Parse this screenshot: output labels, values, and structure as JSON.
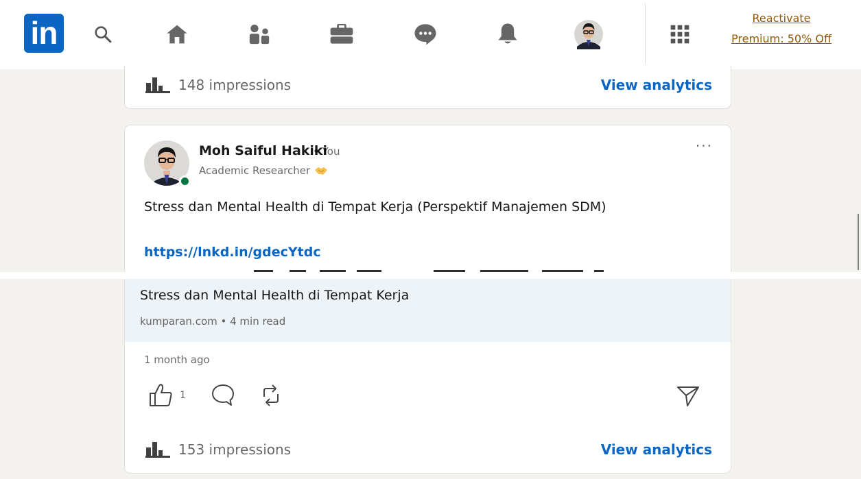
{
  "nav": {
    "logo_text": "in",
    "icons": [
      "search-icon",
      "home-icon",
      "my-network-icon",
      "jobs-icon",
      "messaging-icon",
      "notifications-icon",
      "profile-avatar",
      "work-grid-icon"
    ],
    "premium_link": "Reactivate Premium: 50% Off"
  },
  "prev_post": {
    "impressions": "148 impressions",
    "analytics_label": "View analytics"
  },
  "post": {
    "author_name": "Moh Saiful Hakiki",
    "author_relation": "• You",
    "author_headline": "Academic Researcher",
    "headline_emoji": "handshake-emoji",
    "more_label": "···",
    "text": "Stress dan Mental Health di Tempat Kerja (Perspektif Manajemen SDM)",
    "link": "https://lnkd.in/gdecYtdc",
    "article_title": "Stress dan Mental Health di Tempat Kerja",
    "article_meta": "kumparan.com • 4 min read",
    "time": "1 month ago",
    "like_count": "1",
    "impressions": "153 impressions",
    "analytics_label": "View analytics"
  },
  "colors": {
    "brand_blue": "#0a66c2",
    "premium_gold": "#915907",
    "online_green": "#057642",
    "article_bg": "#eef3f8"
  }
}
